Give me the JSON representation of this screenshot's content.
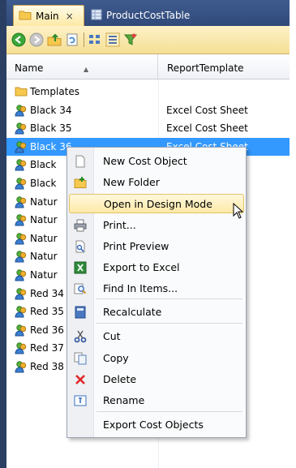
{
  "tabs": [
    {
      "label": "Main",
      "icon": "folder-icon",
      "active": true,
      "close": "×"
    },
    {
      "label": "ProductCostTable",
      "icon": "table-icon",
      "active": false
    }
  ],
  "toolbar": {
    "icons": [
      "back-icon",
      "forward-icon",
      "up-folder-icon",
      "refresh-icon",
      "large-icons-view-icon",
      "details-view-icon",
      "filter-icon"
    ]
  },
  "columns": {
    "name": "Name",
    "template": "ReportTemplate"
  },
  "rows": [
    {
      "name": "Templates",
      "template": "",
      "type": "folder"
    },
    {
      "name": "Black 34",
      "template": "Excel Cost Sheet",
      "type": "cost-object"
    },
    {
      "name": "Black 35",
      "template": "Excel Cost Sheet",
      "type": "cost-object"
    },
    {
      "name": "Black 36",
      "template": "Excel Cost Sheet",
      "type": "cost-object",
      "selected": true
    },
    {
      "name": "Black",
      "template": "",
      "type": "cost-object"
    },
    {
      "name": "Black",
      "template": "",
      "type": "cost-object"
    },
    {
      "name": "Natur",
      "template": "",
      "type": "cost-object"
    },
    {
      "name": "Natur",
      "template": "",
      "type": "cost-object"
    },
    {
      "name": "Natur",
      "template": "",
      "type": "cost-object"
    },
    {
      "name": "Natur",
      "template": "",
      "type": "cost-object"
    },
    {
      "name": "Natur",
      "template": "",
      "type": "cost-object"
    },
    {
      "name": "Red 34",
      "template": "",
      "type": "cost-object"
    },
    {
      "name": "Red 35",
      "template": "",
      "type": "cost-object"
    },
    {
      "name": "Red 36",
      "template": "",
      "type": "cost-object"
    },
    {
      "name": "Red 37",
      "template": "",
      "type": "cost-object"
    },
    {
      "name": "Red 38",
      "template": "",
      "type": "cost-object"
    }
  ],
  "context_menu": [
    {
      "label": "New Cost Object",
      "icon": "new-document-icon"
    },
    {
      "label": "New Folder",
      "icon": "new-folder-icon"
    },
    {
      "label": "Open in Design Mode",
      "icon": "",
      "highlighted": true
    },
    {
      "label": "Print...",
      "icon": "printer-icon"
    },
    {
      "label": "Print Preview",
      "icon": "print-preview-icon"
    },
    {
      "label": "Export to Excel",
      "icon": "excel-icon"
    },
    {
      "label": "Find In Items...",
      "icon": "find-icon"
    },
    {
      "label": "Recalculate",
      "icon": "calculator-icon"
    },
    {
      "label": "Cut",
      "icon": "scissors-icon"
    },
    {
      "label": "Copy",
      "icon": "copy-icon"
    },
    {
      "label": "Delete",
      "icon": "delete-x-icon"
    },
    {
      "label": "Rename",
      "icon": "rename-icon"
    },
    {
      "label": "Export Cost Objects",
      "icon": ""
    }
  ],
  "colors": {
    "accent": "#3399ff",
    "tab_active": "#fde9a4",
    "titlebar": "#30497a",
    "menu_highlight": "#fde9a8"
  }
}
